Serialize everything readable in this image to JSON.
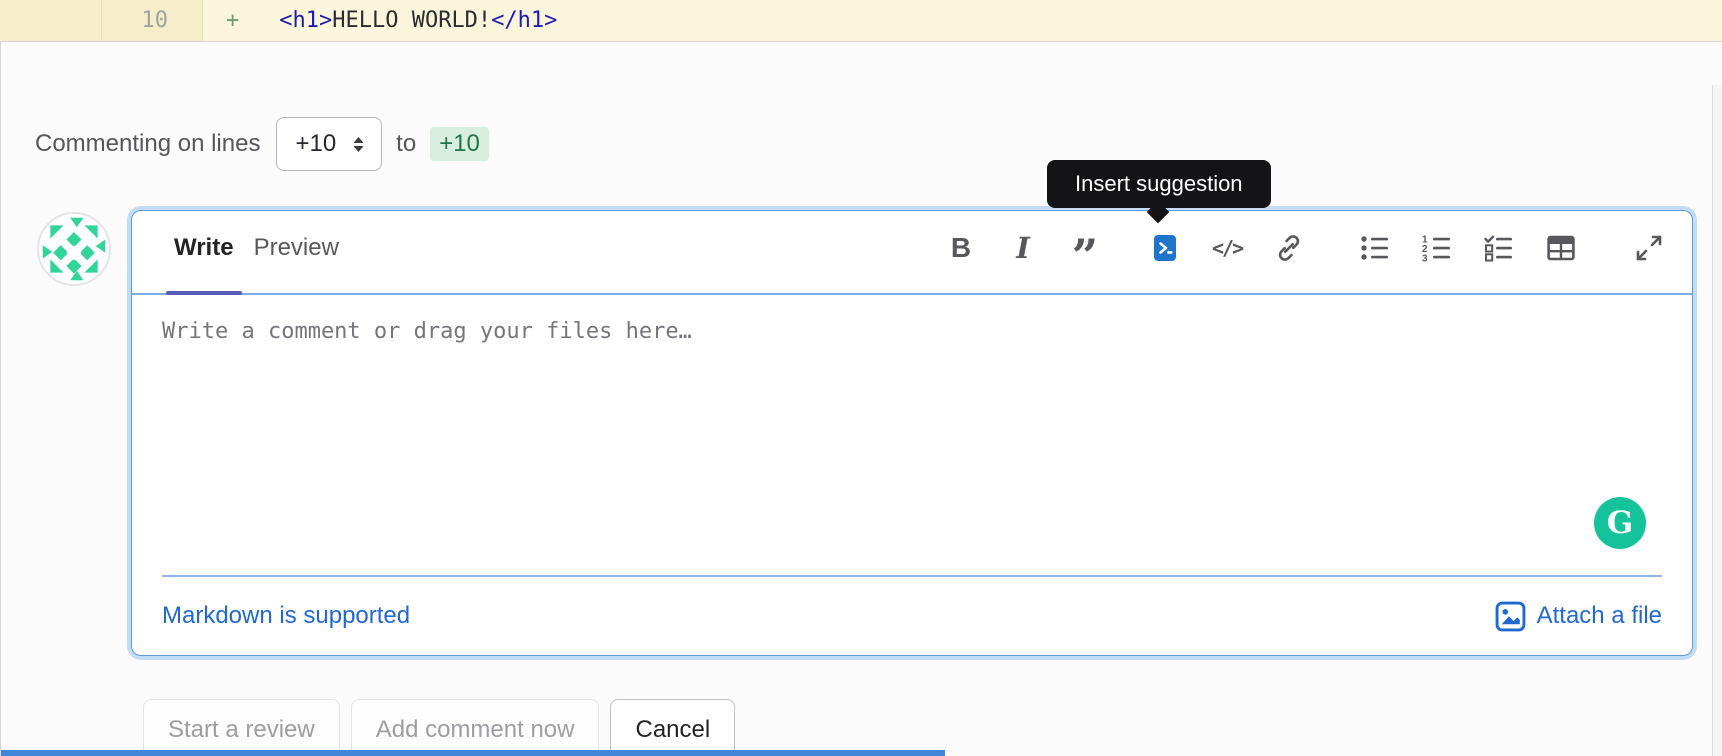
{
  "diff_line": {
    "old_line": "",
    "new_line": "10",
    "sign": "+",
    "code_prefix": "<h1>",
    "code_text": "HELLO WORLD!",
    "code_suffix": "</h1>"
  },
  "comment_header": {
    "label": "Commenting on lines",
    "start_line": "+10",
    "to_label": "to",
    "end_line": "+10"
  },
  "tooltip": {
    "text": "Insert suggestion"
  },
  "editor": {
    "tabs": {
      "write": "Write",
      "preview": "Preview"
    },
    "toolbar_icons": [
      "bold-icon",
      "italic-icon",
      "quote-icon",
      "insert-suggestion-icon",
      "code-icon",
      "link-icon",
      "bullet-list-icon",
      "numbered-list-icon",
      "task-list-icon",
      "table-icon",
      "fullscreen-icon"
    ],
    "glyphs": {
      "bold": "B",
      "italic": "I",
      "quote": "”",
      "code": "</>"
    },
    "placeholder": "Write a comment or drag your files here…",
    "markdown_link": "Markdown is supported",
    "attach_label": "Attach a file",
    "grammarly_letter": "G"
  },
  "actions": {
    "start_review": "Start a review",
    "add_comment": "Add comment now",
    "cancel": "Cancel"
  },
  "colors": {
    "accent_blue": "#1f75cb",
    "link_blue": "#2268d1",
    "focus_ring": "#c3dcf6",
    "added_line_bg": "#fbf5dc",
    "badge_green_bg": "#d8eede",
    "badge_green_text": "#24754c",
    "grammarly_green": "#15c39a",
    "tooltip_bg": "#141417",
    "active_tab_indicator": "#5a5ab8"
  }
}
